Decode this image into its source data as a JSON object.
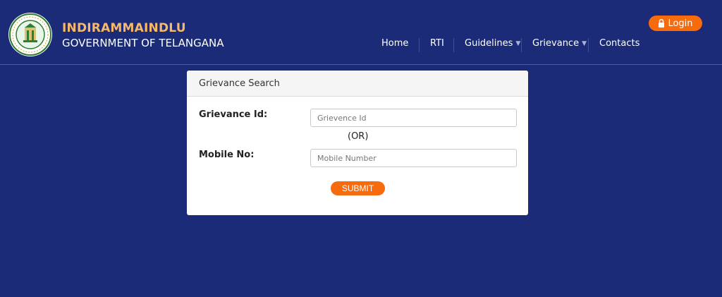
{
  "header": {
    "title": "INDIRAMMAINDLU",
    "subtitle": "GOVERNMENT OF TELANGANA",
    "login_label": "Login",
    "logo_icon": "telangana-emblem-icon"
  },
  "nav": {
    "items": [
      {
        "label": "Home"
      },
      {
        "label": "RTI"
      },
      {
        "label": "Guidelines",
        "has_dropdown": true
      },
      {
        "label": "Grievance",
        "has_dropdown": true
      },
      {
        "label": "Contacts"
      }
    ]
  },
  "card": {
    "title": "Grievance Search",
    "grievance_label": "Grievance Id:",
    "grievance_placeholder": "Grievence Id",
    "or_text": "(OR)",
    "mobile_label": "Mobile No:",
    "mobile_placeholder": "Mobile Number",
    "submit_label": "SUBMIT"
  },
  "colors": {
    "background": "#1b2b78",
    "accent": "#f76b0c",
    "brand_title": "#f7b86b"
  }
}
